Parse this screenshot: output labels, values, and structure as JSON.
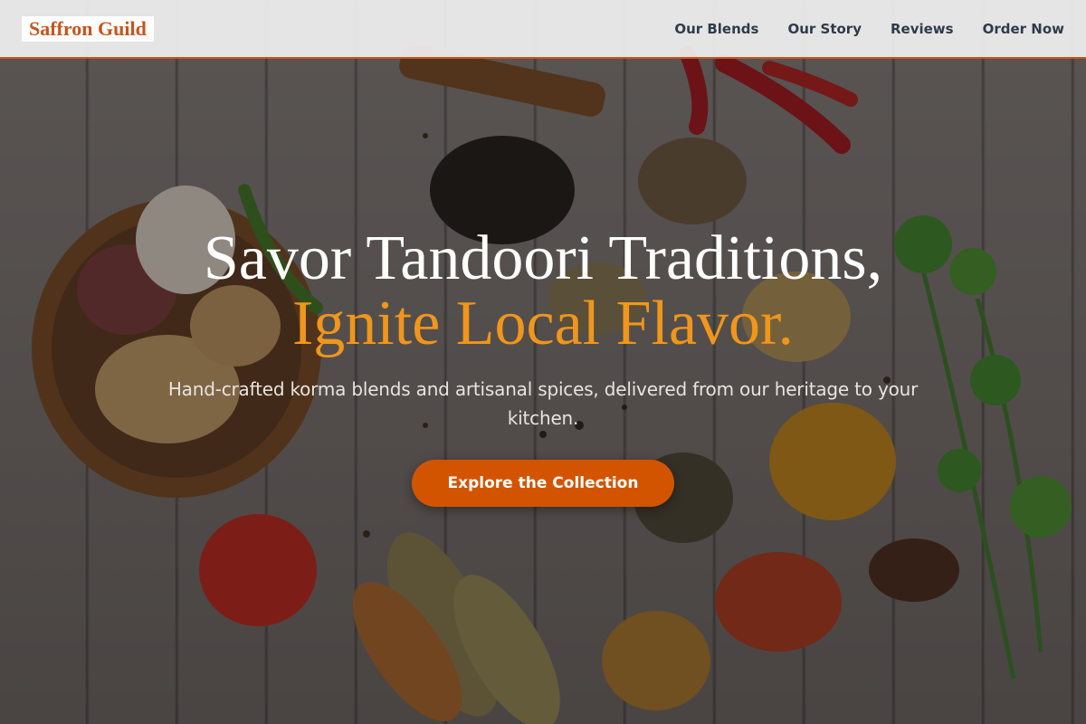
{
  "brand": {
    "name": "Saffron Guild",
    "accent_color": "#c9541a"
  },
  "nav": {
    "links": [
      {
        "label": "Our Blends"
      },
      {
        "label": "Our Story"
      },
      {
        "label": "Reviews"
      },
      {
        "label": "Order Now"
      }
    ]
  },
  "hero": {
    "headline_line1": "Savor Tandoori Traditions,",
    "headline_line2": "Ignite Local Flavor.",
    "headline_accent_color": "#f0961c",
    "subtitle": "Hand-crafted korma blends and artisanal spices, delivered from our heritage to your kitchen.",
    "cta_label": "Explore the Collection",
    "cta_color": "#d35400",
    "background_image": "spice-flatlay-photo"
  }
}
